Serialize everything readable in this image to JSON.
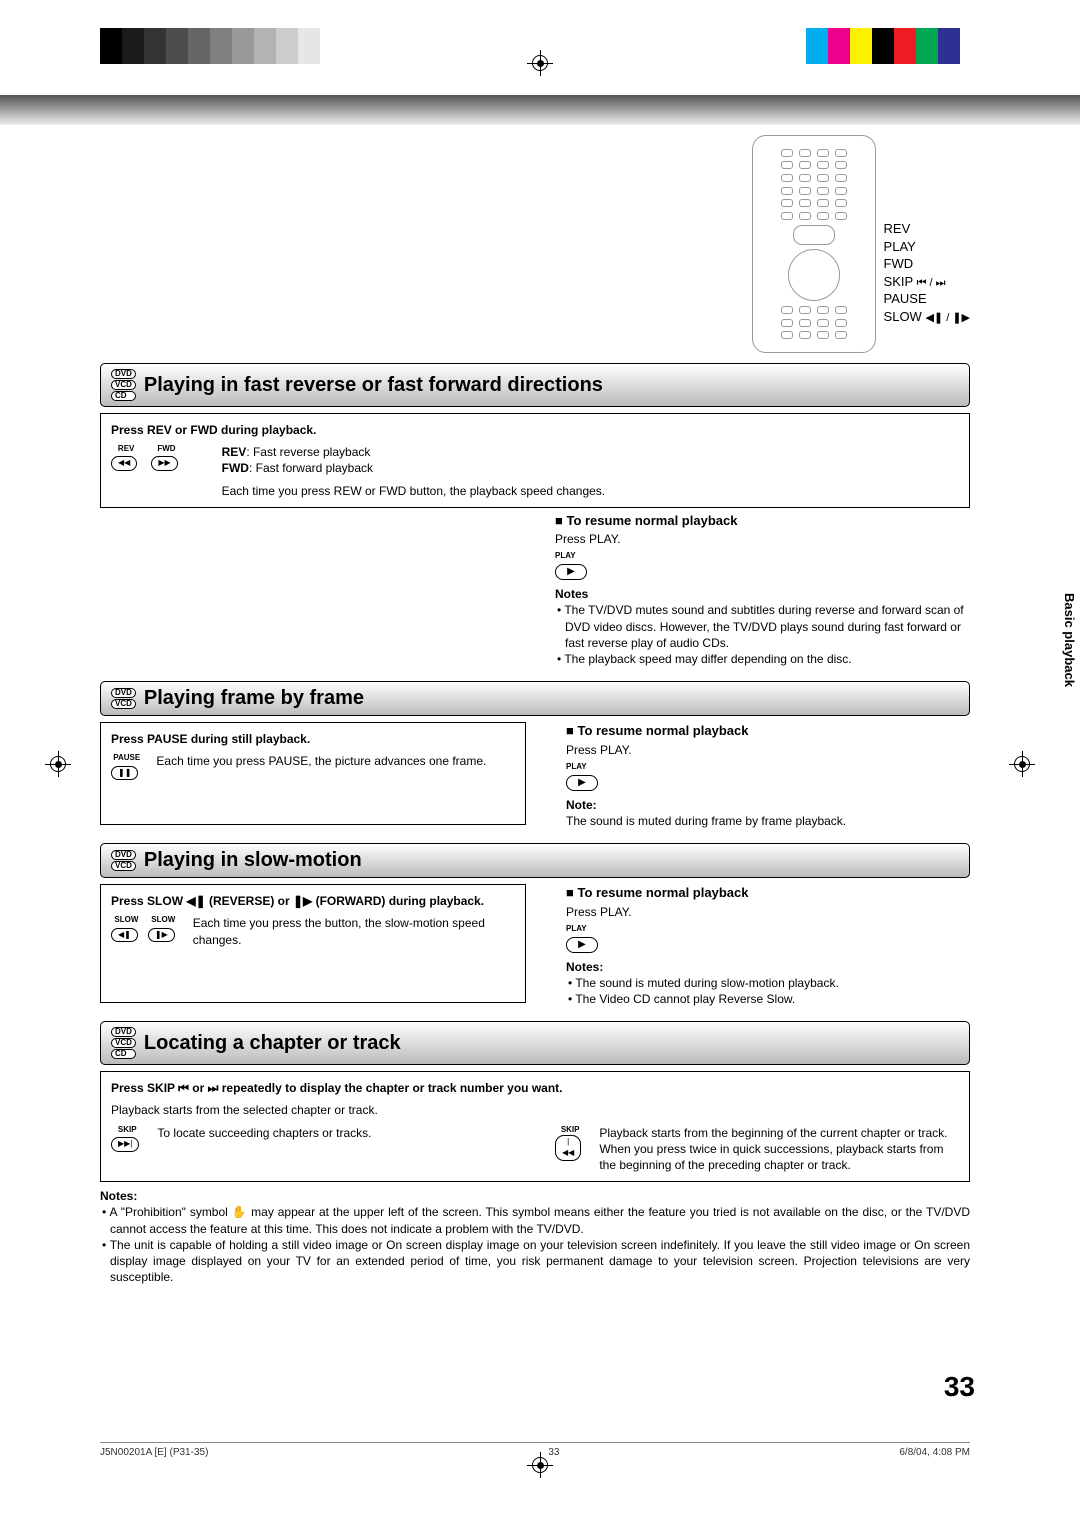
{
  "remote_labels": {
    "rev": "REV",
    "play": "PLAY",
    "fwd": "FWD",
    "skip": "SKIP",
    "skip_glyph": "⏮ / ⏭",
    "pause": "PAUSE",
    "slow": "SLOW",
    "slow_glyph": "◀❚ / ❚▶"
  },
  "side_tab": "Basic playback",
  "page_number": "33",
  "sections": {
    "s1": {
      "discs": [
        "DVD",
        "VCD",
        "CD"
      ],
      "title": "Playing in fast reverse or fast forward directions",
      "left_h": "Press REV or FWD during playback.",
      "rev_label": "REV",
      "rev_desc": ": Fast reverse playback",
      "fwd_label": "FWD",
      "fwd_desc": ": Fast forward playback",
      "btn_rev": "REV",
      "btn_fwd": "FWD",
      "para": "Each time you press REW or FWD button, the playback speed changes.",
      "right_h": "To resume normal playback",
      "press_play": "Press PLAY.",
      "play_btn_label": "PLAY",
      "notes_h": "Notes",
      "note1": "• The TV/DVD mutes sound and subtitles during reverse and forward scan of DVD video discs. However, the TV/DVD plays sound during fast forward or fast reverse play of audio CDs.",
      "note2": "• The playback speed may differ depending on the disc."
    },
    "s2": {
      "discs": [
        "DVD",
        "VCD"
      ],
      "title": "Playing frame by frame",
      "left_h": "Press PAUSE during still playback.",
      "btn_pause": "PAUSE",
      "para": "Each time you press PAUSE, the picture advances one frame.",
      "right_h": "To resume normal playback",
      "press_play": "Press PLAY.",
      "play_btn_label": "PLAY",
      "note_h": "Note:",
      "note": "The sound is muted during frame by frame playback."
    },
    "s3": {
      "discs": [
        "DVD",
        "VCD"
      ],
      "title": "Playing in slow-motion",
      "left_h": "Press SLOW ◀❚ (REVERSE) or ❚▶ (FORWARD) during playback.",
      "btn_slow": "SLOW",
      "para": "Each time you press the button, the slow-motion speed changes.",
      "right_h": "To resume normal playback",
      "press_play": "Press PLAY.",
      "play_btn_label": "PLAY",
      "notes_h": "Notes:",
      "note1": "• The sound is muted during slow-motion playback.",
      "note2": "• The Video CD cannot play Reverse Slow."
    },
    "s4": {
      "discs": [
        "DVD",
        "VCD",
        "CD"
      ],
      "title": "Locating a chapter or track",
      "instr": "Press SKIP ⏮ or ⏭ repeatedly to display the chapter or track number you want.",
      "sub": "Playback starts from the selected chapter or track.",
      "btn_skip": "SKIP",
      "left_col": "To locate succeeding chapters or tracks.",
      "right_col1": "Playback starts from the beginning of the current chapter or track.",
      "right_col2": "When you press twice in quick successions, playback starts from the beginning of the preceding chapter or track."
    },
    "bottom_notes": {
      "h": "Notes:",
      "n1": "• A \"Prohibition\" symbol ✋ may appear at the upper left of the screen. This symbol means either the feature you tried is not available on the disc, or the TV/DVD cannot access the feature at this time. This does not indicate a problem with the TV/DVD.",
      "n2": "• The unit is capable of holding a still video image or On screen display image on your television screen indefinitely. If you leave the still video image or On screen display image displayed on your TV for an extended period of time, you risk permanent damage to your television screen. Projection televisions are very susceptible."
    }
  },
  "footer": {
    "left": "J5N00201A [E] (P31-35)",
    "center": "33",
    "right": "6/8/04, 4:08 PM"
  }
}
